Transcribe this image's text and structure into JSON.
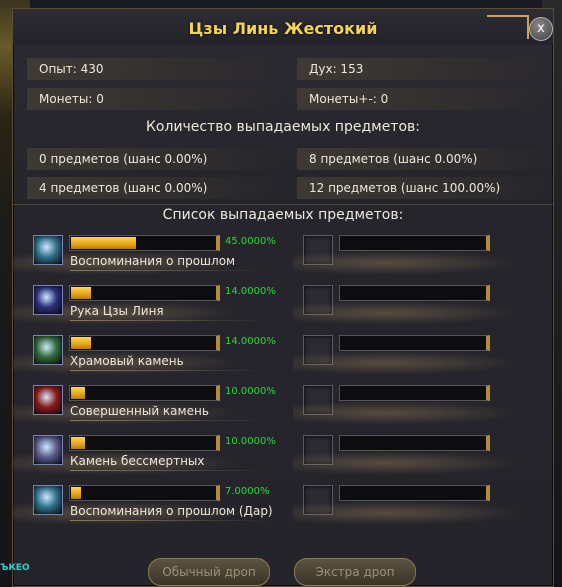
{
  "window": {
    "title": "Цзы Линь Жестокий",
    "close_label": "x"
  },
  "stats": {
    "exp": "Опыт: 430",
    "spirit": "Дух: 153",
    "coins": "Монеты: 0",
    "coins_plus": "Монеты+-: 0"
  },
  "drop_count": {
    "title": "Количество выпадаемых предметов:",
    "items": [
      "0 предметов (шанс 0.00%)",
      "8 предметов (шанс 0.00%)",
      "4 предметов (шанс 0.00%)",
      "12 предметов (шанс 100.00%)"
    ]
  },
  "drop_list": {
    "title": "Список выпадаемых предметов:",
    "items": [
      {
        "name": "Воспоминания о прошлом",
        "pct": "45.0000%",
        "fill": 0.45,
        "icon": "memory-scroll-icon",
        "color": "#2f6f8a"
      },
      {
        "name": "Рука Цзы Линя",
        "pct": "14.0000%",
        "fill": 0.14,
        "icon": "hand-icon",
        "color": "#2a2f7a"
      },
      {
        "name": "Храмовый камень",
        "pct": "14.0000%",
        "fill": 0.14,
        "icon": "temple-stone-icon",
        "color": "#2f6a3a"
      },
      {
        "name": "Совершенный камень",
        "pct": "10.0000%",
        "fill": 0.1,
        "icon": "perfect-stone-icon",
        "color": "#8a1a1a"
      },
      {
        "name": "Камень бессмертных",
        "pct": "10.0000%",
        "fill": 0.1,
        "icon": "immortal-stone-icon",
        "color": "#5a5a8a"
      },
      {
        "name": "Воспоминания о прошлом (Дар)",
        "pct": "7.0000%",
        "fill": 0.07,
        "icon": "memory-scroll-gift-icon",
        "color": "#2f6f8a"
      }
    ]
  },
  "buttons": {
    "normal": "Обычный дроп",
    "extra": "Экстра дроп"
  },
  "corner_text": "ЪКЕО"
}
